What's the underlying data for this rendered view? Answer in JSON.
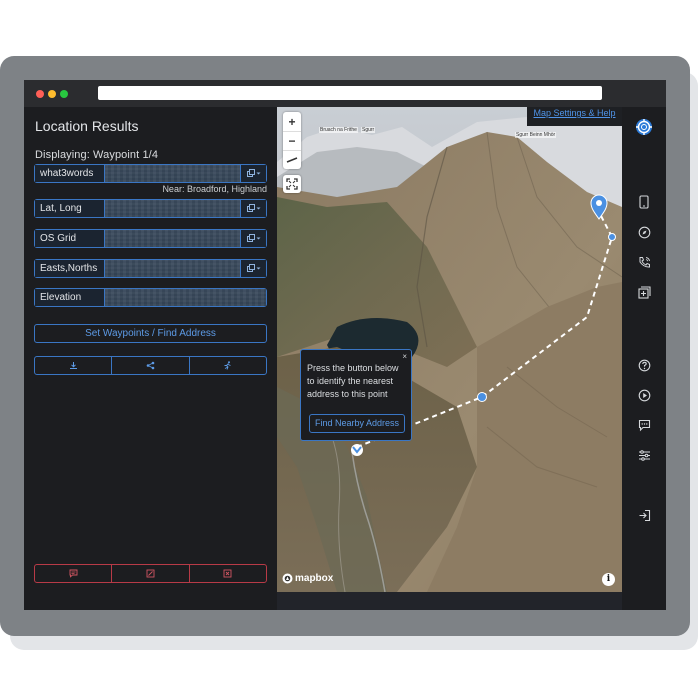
{
  "panel": {
    "title": "Location Results",
    "displaying": "Displaying: Waypoint 1/4",
    "near": "Near: Broadford, Highland",
    "fields": [
      {
        "label": "what3words",
        "value": ""
      },
      {
        "label": "Lat, Long",
        "value": ""
      },
      {
        "label": "OS Grid",
        "value": ""
      },
      {
        "label": "Easts,Norths",
        "value": ""
      },
      {
        "label": "Elevation",
        "value": ""
      }
    ],
    "set_waypoints_label": "Set Waypoints / Find Address"
  },
  "map": {
    "settings_link": "Map Settings & Help",
    "zoom_in": "+",
    "zoom_out": "−",
    "logo_text": "mapbox",
    "info_glyph": "i",
    "popup": {
      "close": "×",
      "message": "Press the button below to identify the nearest address to this point",
      "button": "Find Nearby Address"
    },
    "peak_labels": [
      "Bruach na Frithe",
      "Sgurr",
      "Sgurr Beinn Mhòr"
    ]
  },
  "colors": {
    "accent_blue": "#3a76c4",
    "link_blue": "#4f93e8",
    "danger_red": "#b83a47",
    "panel_bg": "#1c1d20",
    "route_marker": "#4a90e2"
  },
  "icons": {
    "action_row": [
      "download-icon",
      "share-icon",
      "running-icon"
    ],
    "danger_row": [
      "comment-icon",
      "edit-icon",
      "close-square-icon"
    ],
    "rail": [
      "lifebuoy-icon",
      "phone-icon",
      "compass-icon",
      "call-icon",
      "plus-square-icon",
      "help-icon",
      "play-icon",
      "message-icon",
      "sliders-icon",
      "logout-icon"
    ]
  }
}
